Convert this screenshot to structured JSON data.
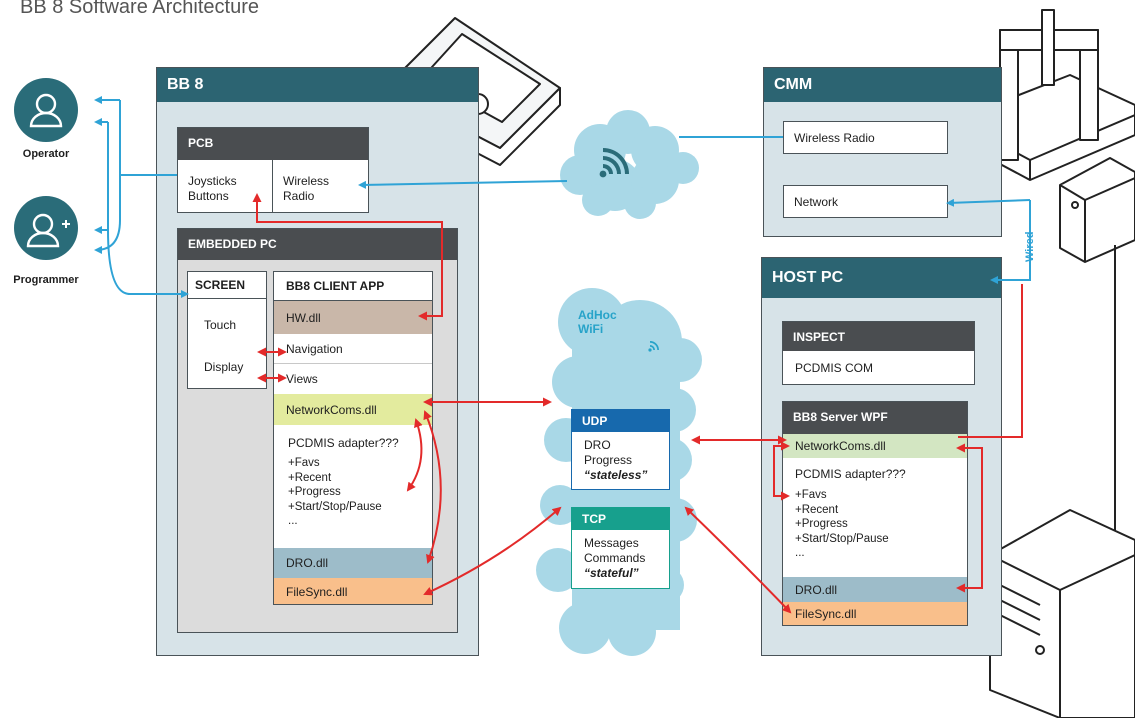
{
  "title": "BB 8 Software Architecture",
  "users": {
    "operator": {
      "label": "Operator",
      "icon": "user-icon"
    },
    "programmer": {
      "label": "Programmer",
      "icon": "user-plus-icon"
    }
  },
  "bb8": {
    "title": "BB 8",
    "pcb": {
      "title": "PCB",
      "joysticks": [
        "Joysticks",
        "Buttons"
      ],
      "wireless": [
        "Wireless",
        "Radio"
      ]
    },
    "embedded_pc": {
      "title": "EMBEDDED PC",
      "screen": {
        "title": "SCREEN",
        "touch": "Touch",
        "display": "Display"
      },
      "client_app": {
        "title": "BB8 CLIENT APP",
        "hw_dll": "HW.dll",
        "navigation": "Navigation",
        "views": "Views",
        "networkcoms": "NetworkComs.dll",
        "adapter": "PCDMIS adapter???",
        "features": [
          "+Favs",
          "+Recent",
          "+Progress",
          "+Start/Stop/Pause",
          "..."
        ],
        "dro": "DRO.dll",
        "filesync": "FileSync.dll"
      }
    }
  },
  "cloud_top": {
    "icon": "wifi-icon"
  },
  "adhoc": {
    "label": [
      "AdHoc",
      "WiFi"
    ],
    "icon": "wifi-icon",
    "udp": {
      "title": "UDP",
      "lines": [
        "DRO",
        "Progress"
      ],
      "tag": "“stateless”"
    },
    "tcp": {
      "title": "TCP",
      "lines": [
        "Messages",
        "Commands"
      ],
      "tag": "“stateful”"
    }
  },
  "cmm": {
    "title": "CMM",
    "wireless": "Wireless Radio",
    "network": "Network"
  },
  "wired_label": "Wired",
  "host_pc": {
    "title": "HOST PC",
    "inspect": {
      "title": "INSPECT",
      "item": "PCDMIS COM"
    },
    "server": {
      "title": "BB8 Server WPF",
      "networkcoms": "NetworkComs.dll",
      "adapter": "PCDMIS adapter???",
      "features": [
        "+Favs",
        "+Recent",
        "+Progress",
        "+Start/Stop/Pause",
        "..."
      ],
      "dro": "DRO.dll",
      "filesync": "FileSync.dll"
    }
  },
  "colors": {
    "frame_bg": "#d7e3e8",
    "frame_title": "#2c6472",
    "dark_header": "#4a4d50",
    "hw_dll": "#c9b7a9",
    "networkcoms": "#e3eb9e",
    "networkcoms_server": "#d3e6c2",
    "dro": "#9dbcc9",
    "filesync": "#f9bf8b",
    "udp": "#1769ad",
    "tcp": "#17a08d",
    "cloud": "#a9d8e7",
    "arrow_red": "#e32a2a",
    "arrow_blue": "#2fa3d6",
    "user_circle": "#2a6c79"
  }
}
